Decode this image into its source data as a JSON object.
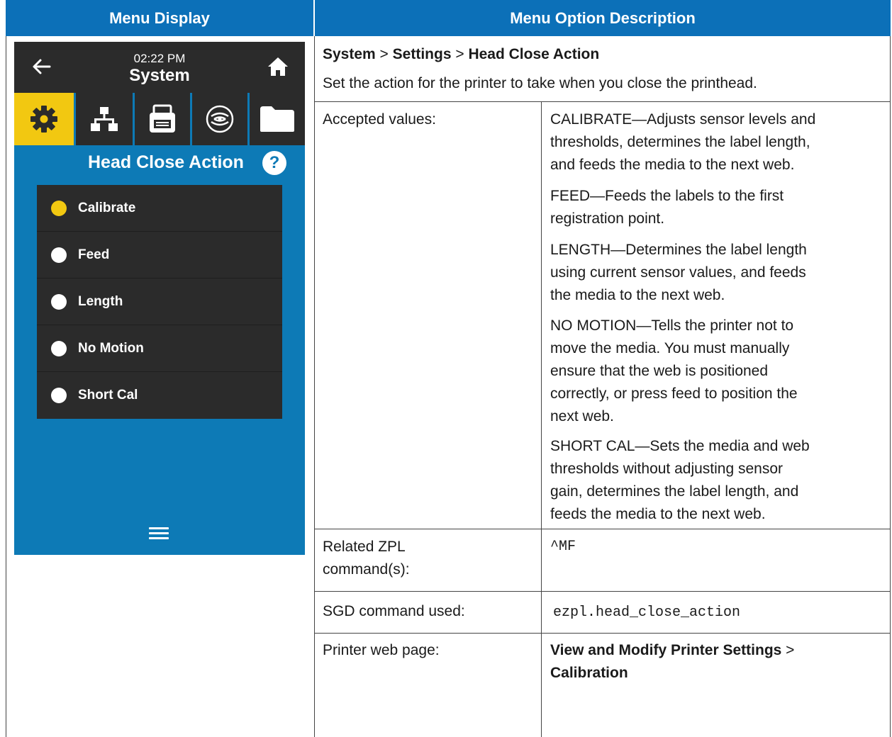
{
  "header": {
    "left": "Menu Display",
    "right": "Menu Option Description"
  },
  "device": {
    "time": "02:22 PM",
    "title": "System",
    "heading": "Head Close Action",
    "help": "?",
    "options": [
      {
        "label": "Calibrate",
        "selected": true
      },
      {
        "label": "Feed",
        "selected": false
      },
      {
        "label": "Length",
        "selected": false
      },
      {
        "label": "No Motion",
        "selected": false
      },
      {
        "label": "Short Cal",
        "selected": false
      }
    ],
    "colors": {
      "screen": "#0d7ab6",
      "bar": "#2b2b2b",
      "accent": "#f2c811"
    },
    "icons": [
      "back-arrow-icon",
      "home-icon",
      "gear-icon",
      "network-icon",
      "printer-icon",
      "wireless-icon",
      "folder-icon",
      "menu-icon"
    ]
  },
  "description": {
    "path": {
      "p1": "System",
      "sep1": " > ",
      "p2": "Settings",
      "sep2": " > ",
      "p3": "Head Close Action"
    },
    "summary": "Set the action for the printer to take when you close the printhead.",
    "rows": {
      "accepted_label": "Accepted values:",
      "values": [
        [
          "CALIBRATE—Adjusts sensor levels and",
          "thresholds, determines the label length,",
          "and feeds the media to the next web."
        ],
        [
          "FEED—Feeds the labels to the first",
          "registration point."
        ],
        [
          "LENGTH—Determines the label length",
          "using current sensor values, and feeds",
          "the media to the next web."
        ],
        [
          "NO MOTION—Tells the printer not to",
          "move the media. You must manually",
          "ensure that the web is positioned",
          "correctly, or press feed to position the",
          "next web."
        ],
        [
          "SHORT CAL—Sets the media and web",
          "thresholds without adjusting sensor",
          "gain, determines the label length, and",
          "feeds the media to the next web."
        ]
      ],
      "zpl_label_1": "Related ZPL",
      "zpl_label_2": "command(s):",
      "zpl_value": "^MF",
      "sgd_label": "SGD command used:",
      "sgd_value": "ezpl.head_close_action",
      "web_label": "Printer web page:",
      "web_value_1": "View and Modify Printer Settings",
      "web_sep": " >",
      "web_value_2": "Calibration"
    },
    "header_color": "#0c70b8"
  }
}
